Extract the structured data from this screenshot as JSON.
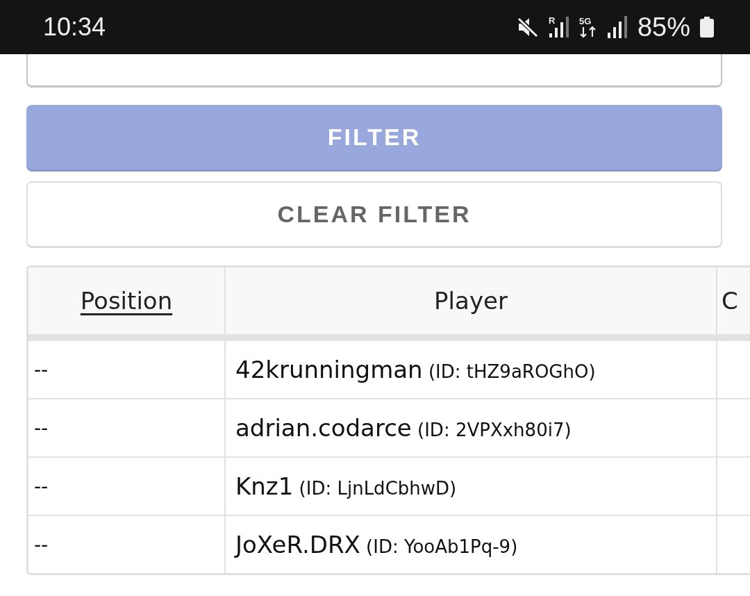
{
  "status_bar": {
    "time": "10:34",
    "roaming": "R",
    "network": "5G",
    "battery": "85%"
  },
  "buttons": [
    {
      "kind": "primary",
      "label": "FILTER"
    },
    {
      "kind": "secondary",
      "label": "CLEAR FILTER"
    }
  ],
  "table": {
    "columns": [
      {
        "label": "Position",
        "sortable": true
      },
      {
        "label": "Player",
        "sortable": false
      },
      {
        "label": "C",
        "sortable": false
      }
    ],
    "rows": [
      {
        "position": "--",
        "name": "42krunningman",
        "id": "(ID: tHZ9aROGhO)"
      },
      {
        "position": "--",
        "name": "adrian.codarce",
        "id": "(ID: 2VPXxh80i7)"
      },
      {
        "position": "--",
        "name": "Knz1",
        "id": "(ID: LjnLdCbhwD)"
      },
      {
        "position": "--",
        "name": "JoXeR.DRX",
        "id": "(ID: YooAb1Pq-9)"
      }
    ]
  }
}
